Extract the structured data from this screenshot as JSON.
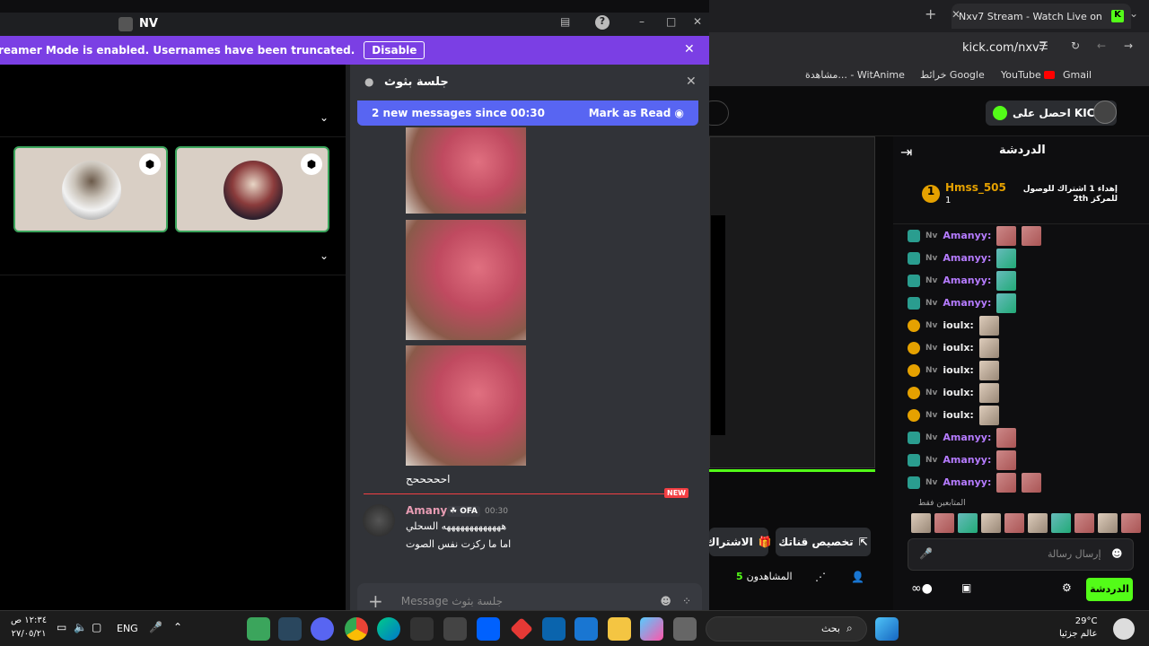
{
  "discord": {
    "title": "NV",
    "banner_text": "reamer Mode is enabled. Usernames have been truncated.",
    "banner_button": "Disable",
    "thread_title": "جلسة بثوث",
    "new_messages": "2 new messages since 00:30",
    "mark_read": "Mark as Read",
    "image_caption": "احححححح",
    "new_label": "NEW",
    "msg_author": "Amany",
    "msg_tag": "OFA",
    "msg_time": "00:30",
    "msg_line1": "هههههههههههههه السحلي",
    "msg_line2": "اما ما ركزت نفس الصوت",
    "composer_placeholder": "Message جلسة بثوث"
  },
  "chrome": {
    "tab_title": "Nxv7 Stream - Watch Live on K",
    "url": "kick.com/nxv7",
    "bookmarks": [
      "Gmail",
      "YouTube",
      "خرائط Google",
      "مشاهدة... - WitAnime"
    ],
    "get_kicks": "احصل على KICKs",
    "chat_title": "الدردشة",
    "top_gifter": "Hmss_505",
    "top_gifter_count": "1",
    "gift_note": "إهداء 1 اشتراك للوصول للمركز 2th",
    "followers_only": "المتابعين فقط",
    "message_placeholder": "إرسال رسالة",
    "chat_button": "الدردشة",
    "customize": "تخصيص قناتك",
    "subscribe": "الاشتراك",
    "viewers_label": "المشاهدون",
    "viewers_count": "5"
  },
  "chat_rows": [
    {
      "user": "Amanyy:",
      "kind": "kick"
    },
    {
      "user": "Amanyy:",
      "kind": "kick"
    },
    {
      "user": "Amanyy:",
      "kind": "kick"
    },
    {
      "user": "Amanyy:",
      "kind": "kick"
    },
    {
      "user": "ioulx:",
      "kind": "gold"
    },
    {
      "user": "ioulx:",
      "kind": "gold"
    },
    {
      "user": "ioulx:",
      "kind": "gold"
    },
    {
      "user": "ioulx:",
      "kind": "gold"
    },
    {
      "user": "ioulx:",
      "kind": "gold"
    },
    {
      "user": "Amanyy:",
      "kind": "kick"
    },
    {
      "user": "Amanyy:",
      "kind": "kick"
    },
    {
      "user": "Amanyy:",
      "kind": "kick"
    }
  ],
  "taskbar": {
    "time": "١٢:٣٤ ص",
    "date": "٢٧/٠٥/٢١",
    "lang": "ENG",
    "search": "بحث",
    "weather": "29°C",
    "weather_sub": "عالم جزئيا"
  },
  "colors": {
    "accent": "#5865f2",
    "kick_green": "#53fc18",
    "banner": "#7b3fe4"
  }
}
